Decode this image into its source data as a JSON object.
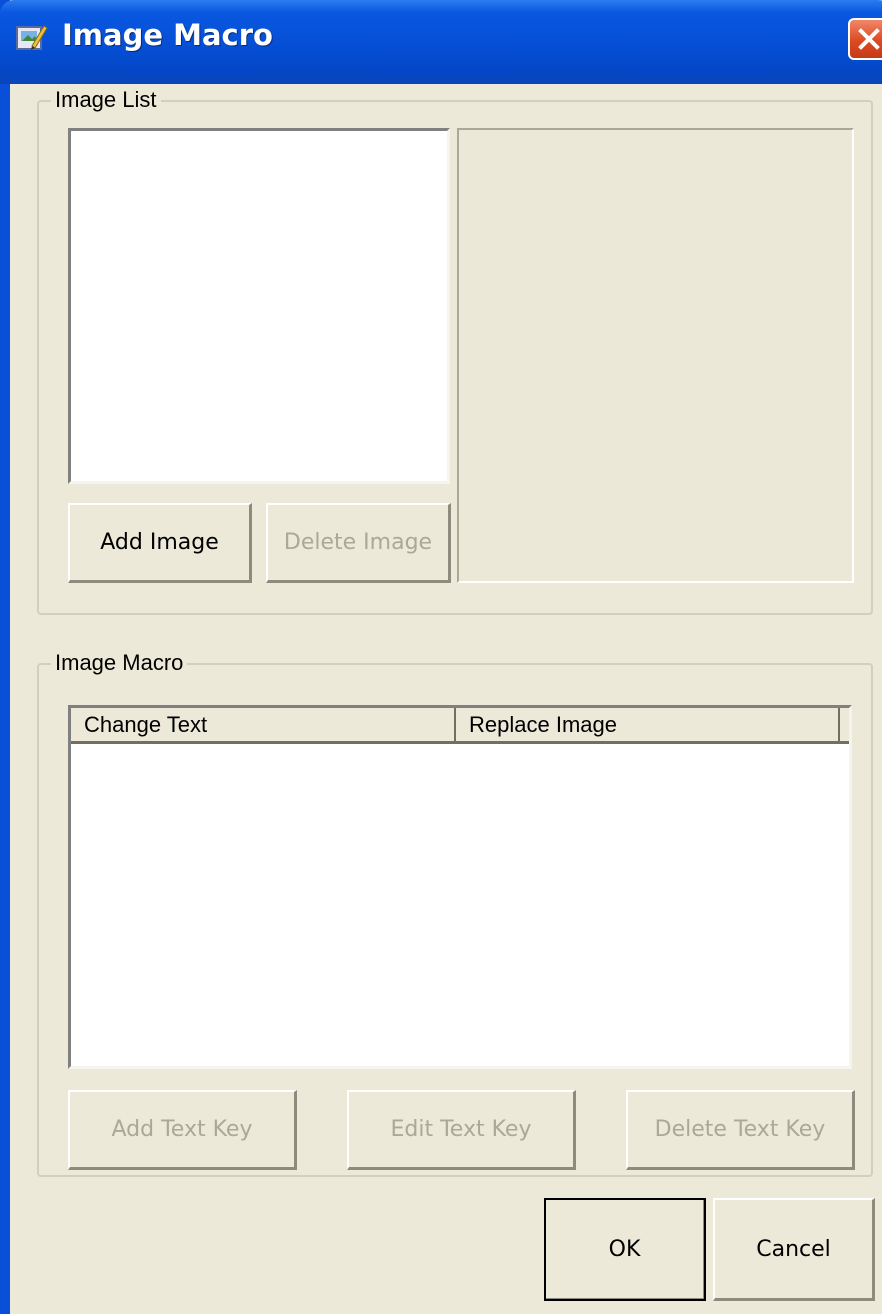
{
  "window": {
    "title": "Image Macro",
    "icon": "image-macro-app-icon"
  },
  "image_list_group": {
    "label": "Image List",
    "items": [],
    "add_button_label": "Add Image",
    "delete_button_label": "Delete Image",
    "delete_enabled": false
  },
  "image_macro_group": {
    "label": "Image Macro",
    "columns": [
      "Change Text",
      "Replace Image"
    ],
    "rows": [],
    "add_button_label": "Add Text Key",
    "edit_button_label": "Edit Text Key",
    "delete_button_label": "Delete Text Key",
    "buttons_enabled": false
  },
  "footer": {
    "ok_label": "OK",
    "cancel_label": "Cancel"
  },
  "colors": {
    "titlebar": "#0550d6",
    "dialog_bg": "#ece9d8",
    "disabled_text": "#aca899",
    "close_button": "#dd4a22"
  }
}
